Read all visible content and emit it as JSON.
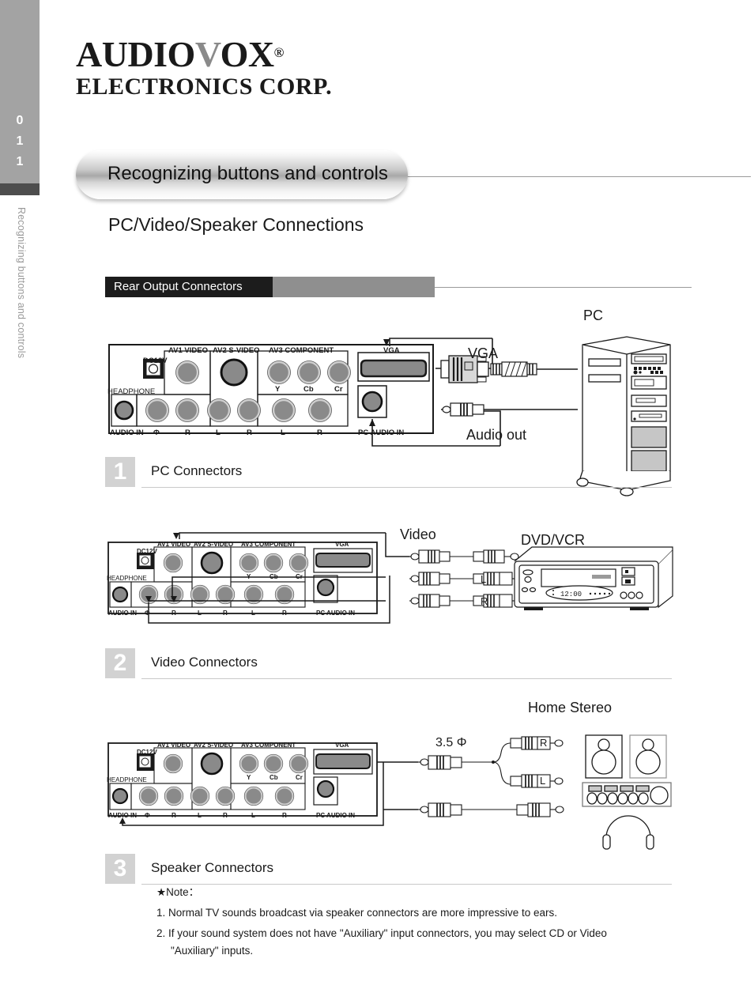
{
  "sidebar": {
    "page_number_digits": [
      "0",
      "1",
      "1"
    ],
    "vertical_text": "Recognizing buttons and controls"
  },
  "logo": {
    "line1_pre": "AUDIO",
    "line1_v": "V",
    "line1_post": "OX",
    "registered": "®",
    "line2": "ELECTRONICS CORP."
  },
  "header": {
    "pill_title": "Recognizing buttons and controls",
    "subtitle": "PC/Video/Speaker Connections",
    "section_bar_label": "Rear Output Connectors"
  },
  "panel": {
    "dc_label": "DC12V",
    "headphone_label": "HEADPHONE",
    "groups": [
      {
        "title": "AV1 VIDEO"
      },
      {
        "title": "AV2 S-VIDEO"
      },
      {
        "title": "AV3 COMPONENT"
      },
      {
        "title": "VGA"
      }
    ],
    "component_sublabels": [
      "Y",
      "Cb",
      "Cr"
    ],
    "bottom_labels": [
      "AUDIO IN",
      "R",
      "L",
      "R",
      "L",
      "R",
      "L"
    ],
    "headphone_glyph": "Φ",
    "pc_audio_in_label": "PC AUDIO IN"
  },
  "sections": [
    {
      "number": "1",
      "title": "PC Connectors",
      "callouts": {
        "device": "PC",
        "vga": "VGA",
        "audio": "Audio out"
      }
    },
    {
      "number": "2",
      "title": "Video Connectors",
      "callouts": {
        "device": "DVD/VCR",
        "cables": "Video",
        "rca_labels": [
          "",
          "L",
          "R"
        ],
        "vcr_clock": "12:00"
      }
    },
    {
      "number": "3",
      "title": "Speaker Connectors",
      "callouts": {
        "device": "Home Stereo",
        "plug": "3.5 Φ",
        "rca_labels": [
          "R",
          "L"
        ]
      }
    }
  ],
  "notes": {
    "heading": "★Note：",
    "items": [
      "1. Normal TV sounds broadcast via speaker connectors are more impressive to  ears.",
      "2. If your sound system does not have \"Auxiliary\" input connectors, you may select CD or Video",
      "\"Auxiliary\" inputs."
    ]
  },
  "colors": {
    "sidebar_gray": "#a3a3a3",
    "sidebar_dark": "#4d4d4d",
    "section_black": "#1c1c1c",
    "section_gray": "#8f8f8f",
    "step_num_bg": "#d2d2d2",
    "jack_fill": "#8a8a8a"
  }
}
